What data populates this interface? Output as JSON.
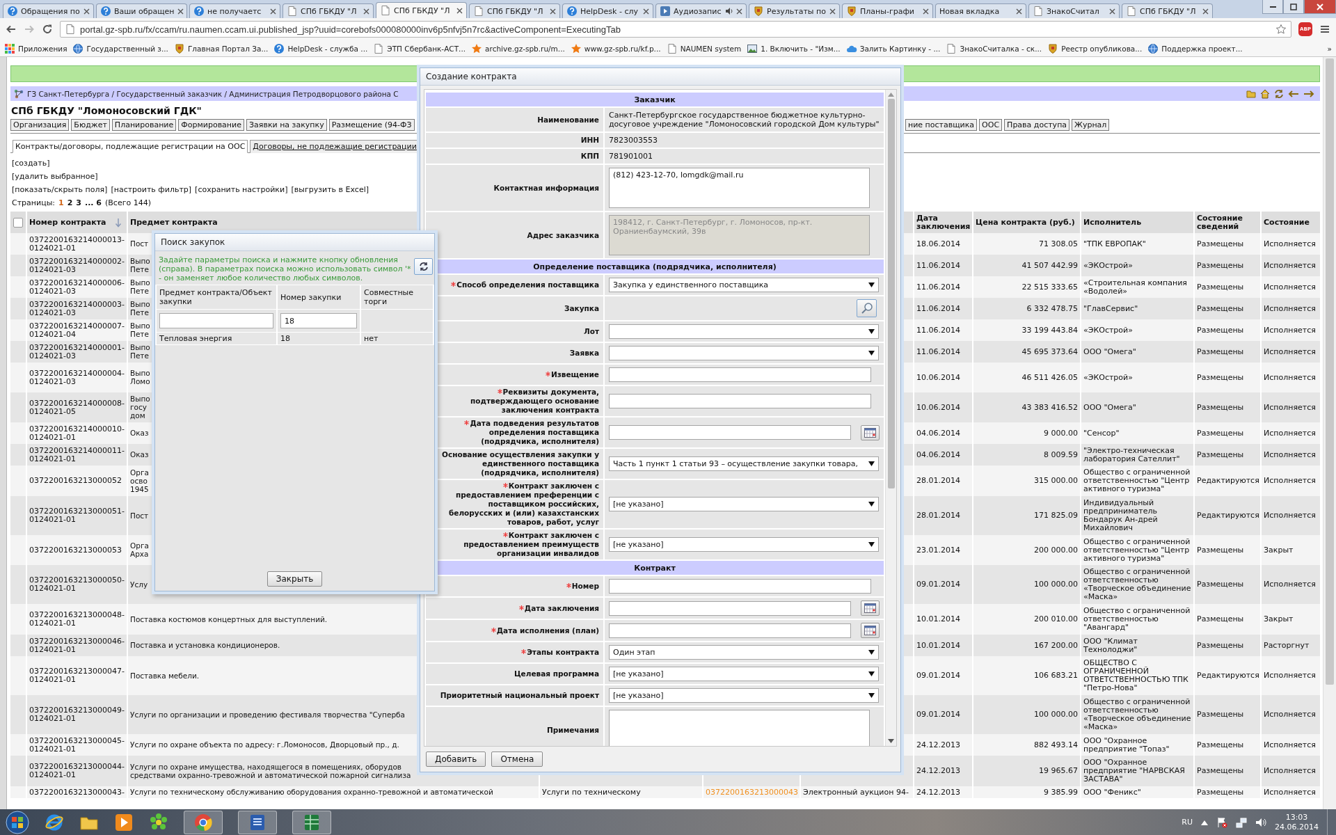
{
  "browser": {
    "tabs": [
      {
        "title": "Обращения по",
        "kind": "help",
        "selected": false,
        "playing": false
      },
      {
        "title": "Ваши обращен",
        "kind": "help",
        "selected": false,
        "playing": false
      },
      {
        "title": "не получаетс",
        "kind": "help",
        "selected": false,
        "playing": false
      },
      {
        "title": "СПб ГБКДУ \"Л",
        "kind": "doc",
        "selected": false,
        "playing": false
      },
      {
        "title": "СПб ГБКДУ \"Л",
        "kind": "doc",
        "selected": true,
        "playing": false
      },
      {
        "title": "СПб ГБКДУ \"Л",
        "kind": "doc",
        "selected": false,
        "playing": false
      },
      {
        "title": "HelpDesk - слу",
        "kind": "help",
        "selected": false,
        "playing": false
      },
      {
        "title": "Аудиозапис",
        "kind": "media",
        "selected": false,
        "playing": true
      },
      {
        "title": "Результаты по",
        "kind": "emblem",
        "selected": false,
        "playing": false
      },
      {
        "title": "Планы-графи",
        "kind": "emblem",
        "selected": false,
        "playing": false
      },
      {
        "title": "Новая вкладка",
        "kind": "none",
        "selected": false,
        "playing": false
      },
      {
        "title": "ЗнакоСчитал",
        "kind": "doc",
        "selected": false,
        "playing": false
      },
      {
        "title": "СПб ГБКДУ \"Л",
        "kind": "doc",
        "selected": false,
        "playing": false
      }
    ],
    "address": "portal.gz-spb.ru/fx/ccam/ru.naumen.ccam.ui.published_jsp?uuid=corebofs000080000inv6p5nfvj5n7rc&activeComponent=ExecutingTab",
    "extension_badge": "ABP",
    "bookmarks": [
      {
        "label": "Приложения",
        "kind": "apps"
      },
      {
        "label": "Государственный з...",
        "kind": "globe"
      },
      {
        "label": "Главная Портал За...",
        "kind": "emblem"
      },
      {
        "label": "HelpDesk - служба ...",
        "kind": "help"
      },
      {
        "label": "ЭТП Сбербанк-АСТ...",
        "kind": "doc"
      },
      {
        "label": "archive.gz-spb.ru/m...",
        "kind": "star"
      },
      {
        "label": "www.gz-spb.ru/kf.p...",
        "kind": "star"
      },
      {
        "label": "NAUMEN system",
        "kind": "doc"
      },
      {
        "label": "1. Включить - \"Изм...",
        "kind": "image"
      },
      {
        "label": "Залить Картинку - ...",
        "kind": "cloud"
      },
      {
        "label": "ЗнакоСчиталка - ск...",
        "kind": "doc"
      },
      {
        "label": "Реестр опубликова...",
        "kind": "emblem"
      },
      {
        "label": "Поддержка проект...",
        "kind": "globe"
      }
    ],
    "bookmarks_more": "»"
  },
  "page": {
    "breadcrumb": "ГЗ Санкт-Петербурга / Государственный заказчик / Администрация Петродворцового района С",
    "title": "СПб ГБКДУ \"Ломоносовский ГДК\"",
    "nav_tabs_left": [
      "Организация",
      "Бюджет",
      "Планирование",
      "Формирование",
      "Заявки на закупку",
      "Размещение (94-ФЗ"
    ],
    "nav_tabs_right": [
      "ние поставщика",
      "ООС",
      "Права доступа",
      "Журнал"
    ],
    "subtabs": [
      {
        "label": "Контракты/договоры, подлежащие регистрации на ООС",
        "selected": true
      },
      {
        "label": "Договоры, не подлежащие регистрации",
        "selected": false
      }
    ],
    "actions": [
      [
        "[создать]"
      ],
      [
        "[удалить выбранное]"
      ],
      [
        "[показать/скрыть поля]",
        "[настроить фильтр]",
        "[сохранить настройки]",
        "[выгрузить в Excel]"
      ]
    ],
    "pagination": {
      "label": "Страницы:",
      "pages": [
        {
          "label": "1",
          "selected": true
        },
        {
          "label": "2",
          "selected": false
        },
        {
          "label": "3",
          "selected": false
        },
        {
          "label": "... 6",
          "selected": false
        }
      ],
      "total": "(Всего 144)"
    },
    "table": {
      "select_all": {
        "checked": false
      },
      "columns": [
        {
          "label": "Номер контракта",
          "sorted": true
        },
        {
          "label": "Предмет контракта",
          "sorted": false
        },
        {
          "label": "Дата заключения",
          "sorted": false
        },
        {
          "label": "Цена контракта (руб.)",
          "sorted": false
        },
        {
          "label": "Исполнитель",
          "sorted": false
        },
        {
          "label": "Состояние сведений",
          "sorted": false
        },
        {
          "label": "Состояние",
          "sorted": false
        }
      ],
      "rows": [
        {
          "number": "0372200163214000013-0124021-01",
          "subject": "Пост",
          "date": "18.06.2014",
          "price": "71 308.05",
          "executor": "\"ТПК ЕВРОПАК\"",
          "info_state": "Размещены",
          "state": "Исполняется"
        },
        {
          "number": "0372200163214000002-0124021-03",
          "subject": "Выпо\nПете",
          "date": "11.06.2014",
          "price": "41 507 442.99",
          "executor": "«ЭКОстрой»",
          "info_state": "Размещены",
          "state": "Исполняется"
        },
        {
          "number": "0372200163214000006-0124021-03",
          "subject": "Выпо\nПете",
          "date": "11.06.2014",
          "price": "22 515 333.65",
          "executor": "«Строительная компания «Водолей»",
          "info_state": "Размещены",
          "state": "Исполняется"
        },
        {
          "number": "0372200163214000003-0124021-03",
          "subject": "Выпо\nПете",
          "date": "11.06.2014",
          "price": "6 332 478.75",
          "executor": "\"ГлавСервис\"",
          "info_state": "Размещены",
          "state": "Исполняется"
        },
        {
          "number": "0372200163214000007-0124021-04",
          "subject": "Выпо\nПете",
          "date": "11.06.2014",
          "price": "33 199 443.84",
          "executor": "«ЭКОстрой»",
          "info_state": "Размещены",
          "state": "Исполняется"
        },
        {
          "number": "0372200163214000001-0124021-03",
          "subject": "Выпо\nПете",
          "date": "11.06.2014",
          "price": "45 695 373.64",
          "executor": "ООО \"Омега\"",
          "info_state": "Размещены",
          "state": "Исполняется"
        },
        {
          "number": "0372200163214000004-0124021-03",
          "subject": "Выпо\nЛомо",
          "date": "10.06.2014",
          "price": "46 511 426.05",
          "executor": "«ЭКОстрой»",
          "info_state": "Размещены",
          "state": "Исполняется"
        },
        {
          "number": "0372200163214000008-0124021-05",
          "subject": "Выпо\nгосу\nдом",
          "date": "10.06.2014",
          "price": "43 383 416.52",
          "executor": "ООО \"Омега\"",
          "info_state": "Размещены",
          "state": "Исполняется"
        },
        {
          "number": "0372200163214000010-0124021-01",
          "subject": "Оказ",
          "date": "04.06.2014",
          "price": "9 000.00",
          "executor": "\"Сенсор\"",
          "info_state": "Размещены",
          "state": "Исполняется"
        },
        {
          "number": "0372200163214000011-0124021-01",
          "subject": "Оказ",
          "date": "04.06.2014",
          "price": "8 009.59",
          "executor": "\"Электро-техническая лаборатория Сателлит\"",
          "info_state": "Размещены",
          "state": "Исполняется"
        },
        {
          "number": "0372200163213000052",
          "subject": "Орга\nосво\n1945",
          "date": "28.01.2014",
          "price": "315 000.00",
          "executor": "Общество с ограниченной ответственностью \"Центр активного туризма\"",
          "info_state": "Редактируются",
          "state": "Исполняется"
        },
        {
          "number": "0372200163213000051-0124021-01",
          "subject": "Пост",
          "date": "28.01.2014",
          "price": "171 825.09",
          "executor": "Индивидуальный предприниматель Бондарук Ан-дрей Михайлович",
          "info_state": "Редактируются",
          "state": "Исполняется"
        },
        {
          "number": "0372200163213000053",
          "subject": "Орга\nАрха",
          "date": "23.01.2014",
          "price": "200 000.00",
          "executor": "Общество с ограниченной ответственностью \"Центр активного туризма\"",
          "info_state": "Размещены",
          "state": "Закрыт"
        },
        {
          "number": "0372200163213000050-0124021-01",
          "subject": "Услу",
          "date": "09.01.2014",
          "price": "100 000.00",
          "executor": "Общество с ограниченной ответственностью «Творческое объединение «Маска»",
          "info_state": "Размещены",
          "state": "Исполняется"
        },
        {
          "number": "0372200163213000048-0124021-01",
          "subject": "Поставка костюмов концертных для выступлений.",
          "date": "10.01.2014",
          "price": "200 010.00",
          "executor": "Общество с ограниченной ответственностью \"Авангард\"",
          "info_state": "Размещены",
          "state": "Закрыт"
        },
        {
          "number": "0372200163213000046-0124021-01",
          "subject": "Поставка и установка кондиционеров.",
          "date": "10.01.2014",
          "price": "167 200.00",
          "executor": "ООО \"Климат Технолоджи\"",
          "info_state": "Размещены",
          "state": "Расторгнут"
        },
        {
          "number": "0372200163213000047-0124021-01",
          "subject": "Поставка мебели.",
          "date": "09.01.2014",
          "price": "106 683.21",
          "executor": "ОБЩЕСТВО С ОГРАНИЧЕННОЙ ОТВЕТСТВЕННОСТЬЮ ТПК \"Петро-Нова\"",
          "info_state": "Редактируются",
          "state": "Исполняется"
        },
        {
          "number": "0372200163213000049-0124021-01",
          "subject": "Услуги по организации и проведению фестиваля творчества \"Суперба",
          "date": "09.01.2014",
          "price": "100 000.00",
          "executor": "Общество с ограниченной ответственностью «Творческое объединение «Маска»",
          "info_state": "Размещены",
          "state": "Исполняется"
        },
        {
          "number": "0372200163213000045-0124021-01",
          "subject": "Услуги по охране объекта по адресу: г.Ломоносов, Дворцовый пр., д.",
          "date": "24.12.2013",
          "price": "882 493.14",
          "executor": "ООО \"Охранное предприятие \"Топаз\"",
          "info_state": "Размещены",
          "state": "Исполняется"
        },
        {
          "number": "0372200163213000044-0124021-01",
          "subject": "Услуги по охране имущества, находящегося в помещениях, оборудов\nсредствами охранно-тревожной и автоматической пожарной сигнализа",
          "date": "24.12.2013",
          "price": "19 965.67",
          "executor": "ООО \"Охранное предприятие \"НАРВСКАЯ ЗАСТАВА\"",
          "info_state": "Размещены",
          "state": "Исполняется"
        },
        {
          "number": "0372200163213000043-",
          "subject": "Услуги по техническому обслуживанию оборудования охранно-тревожной и автоматической",
          "column_4": "Услуги по техническому",
          "column_5": "0372200163213000043",
          "column_6": "Электронный аукцион 94-",
          "date": "24.12.2013",
          "price": "9 385.99",
          "executor": "ООО \"Феникс\"",
          "info_state": "Размещены",
          "state": "Исполняется"
        }
      ]
    }
  },
  "contract_dialog": {
    "title": "Создание контракта",
    "sections": [
      {
        "title": "Заказчик",
        "rows": [
          {
            "kind": "text",
            "label": "Наименование",
            "required": false,
            "disabled": false,
            "value": "Санкт-Петербургское государственное бюджетное культурно-досуговое учреждение \"Ломоносовский городской Дом культуры\""
          },
          {
            "kind": "text",
            "label": "ИНН",
            "required": false,
            "disabled": false,
            "value": "7823003553"
          },
          {
            "kind": "text",
            "label": "КПП",
            "required": false,
            "disabled": false,
            "value": "781901001"
          },
          {
            "kind": "textarea",
            "label": "Контактная информация",
            "required": false,
            "disabled": false,
            "value": "(812) 423-12-70, lomgdk@mail.ru"
          },
          {
            "kind": "textarea",
            "label": "Адрес заказчика",
            "required": false,
            "disabled": true,
            "value": "198412, г. Санкт-Петербург, г. Ломоносов, пр-кт. Ораниенбаумский, 39в"
          }
        ]
      },
      {
        "title": "Определение поставщика (подрядчика, исполнителя)",
        "rows": [
          {
            "kind": "select",
            "label": "Способ определения поставщика",
            "required": true,
            "disabled": false,
            "value": "Закупка у единственного поставщика"
          },
          {
            "kind": "lookup",
            "label": "Закупка",
            "required": false,
            "disabled": false
          },
          {
            "kind": "select",
            "label": "Лот",
            "required": false,
            "disabled": false
          },
          {
            "kind": "select",
            "label": "Заявка",
            "required": false,
            "disabled": false
          },
          {
            "kind": "input",
            "label": "Извещение",
            "required": true,
            "disabled": false
          },
          {
            "kind": "input",
            "label": "Реквизиты документа, подтверждающего основание заключения контракта",
            "required": true,
            "disabled": false
          },
          {
            "kind": "date",
            "label": "Дата подведения результатов определения поставщика (подрядчика, исполнителя)",
            "required": true,
            "disabled": false
          },
          {
            "kind": "select",
            "label": "Основание осуществления закупки у единственного поставщика (подрядчика, исполнителя)",
            "required": false,
            "disabled": false,
            "value": "Часть 1 пункт 1 статьи 93 – осуществление закупки товара,"
          },
          {
            "kind": "select",
            "label": "Контракт заключен с предоставлением преференции с поставщиком российских, белорусских и (или) казахстанских товаров, работ, услуг",
            "required": true,
            "disabled": false,
            "value": "[не указано]"
          },
          {
            "kind": "select",
            "label": "Контракт заключен с предоставлением преимуществ организации инвалидов",
            "required": true,
            "disabled": false,
            "value": "[не указано]"
          }
        ]
      },
      {
        "title": "Контракт",
        "rows": [
          {
            "kind": "input",
            "label": "Номер",
            "required": true,
            "disabled": false
          },
          {
            "kind": "date",
            "label": "Дата заключения",
            "required": true,
            "disabled": false
          },
          {
            "kind": "date",
            "label": "Дата исполнения (план)",
            "required": true,
            "disabled": false
          },
          {
            "kind": "select",
            "label": "Этапы контракта",
            "required": true,
            "disabled": false,
            "value": "Один этап"
          },
          {
            "kind": "select",
            "label": "Целевая программа",
            "required": false,
            "disabled": false,
            "value": "[не указано]"
          },
          {
            "kind": "select",
            "label": "Приоритетный национальный проект",
            "required": false,
            "disabled": false,
            "value": "[не указано]"
          },
          {
            "kind": "textarea",
            "label": "Примечания",
            "required": false,
            "disabled": false
          }
        ]
      }
    ],
    "buttons": [
      "Добавить",
      "Отмена"
    ]
  },
  "search_dialog": {
    "title": "Поиск закупок",
    "hint": "Задайте параметры поиска и нажмите кнопку обновления (справа). В параметрах поиска можно использовать символ '* - он заменяет любое количество любых символов.",
    "columns": [
      "Предмет контракта/Объект закупки",
      "Номер закупки",
      "Совместные торги"
    ],
    "filters": [
      {
        "kind": "input"
      },
      {
        "kind": "input",
        "value": "18"
      },
      {
        "kind": "none"
      }
    ],
    "results": [
      [
        "Тепловая энергия",
        "18",
        "нет"
      ]
    ],
    "button": "Закрыть"
  },
  "taskbar": {
    "language": "RU",
    "time": "13:03",
    "date": "24.06.2014"
  }
}
